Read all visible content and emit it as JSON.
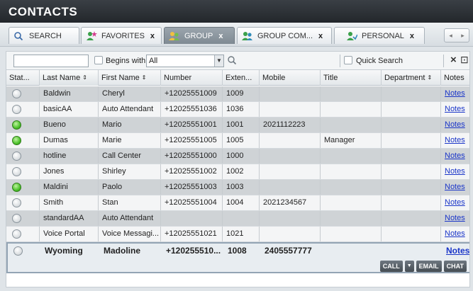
{
  "header": {
    "title": "CONTACTS"
  },
  "tabs": [
    {
      "label": "SEARCH",
      "icon": "search-icon",
      "closable": false,
      "active": false
    },
    {
      "label": "FAVORITES",
      "icon": "favorites-icon",
      "closable": true,
      "active": false
    },
    {
      "label": "GROUP",
      "icon": "group-icon",
      "closable": true,
      "active": true
    },
    {
      "label": "GROUP COM...",
      "icon": "group-common-icon",
      "closable": true,
      "active": false
    },
    {
      "label": "PERSONAL",
      "icon": "personal-icon",
      "closable": true,
      "active": false
    }
  ],
  "tab_close": "x",
  "tab_nav": {
    "prev": "◂",
    "next": "▸"
  },
  "toolbar": {
    "filter_value": "",
    "begins_with_label": "Begins with",
    "select_value": "All",
    "quick_search_label": "Quick Search",
    "clear_icon": "×",
    "export_icon": "⊡"
  },
  "columns": [
    {
      "key": "status",
      "label": "Stat..."
    },
    {
      "key": "last",
      "label": "Last Name",
      "sort": "⇕"
    },
    {
      "key": "first",
      "label": "First Name",
      "sort": "⇕"
    },
    {
      "key": "number",
      "label": "Number"
    },
    {
      "key": "ext",
      "label": "Exten..."
    },
    {
      "key": "mobile",
      "label": "Mobile"
    },
    {
      "key": "title",
      "label": "Title"
    },
    {
      "key": "dept",
      "label": "Department",
      "sort": "⇕"
    },
    {
      "key": "notes",
      "label": "Notes"
    }
  ],
  "rows": [
    {
      "presence": "offline",
      "last": "Baldwin",
      "first": "Cheryl",
      "number": "+12025551009",
      "ext": "1009",
      "mobile": "",
      "title": "",
      "dept": "",
      "notes": "Notes"
    },
    {
      "presence": "offline",
      "last": "basicAA",
      "first": "Auto Attendant",
      "number": "+12025551036",
      "ext": "1036",
      "mobile": "",
      "title": "",
      "dept": "",
      "notes": "Notes"
    },
    {
      "presence": "available",
      "last": "Bueno",
      "first": "Mario",
      "number": "+12025551001",
      "ext": "1001",
      "mobile": "2021112223",
      "title": "",
      "dept": "",
      "notes": "Notes"
    },
    {
      "presence": "available",
      "last": "Dumas",
      "first": "Marie",
      "number": "+12025551005",
      "ext": "1005",
      "mobile": "",
      "title": "Manager",
      "dept": "",
      "notes": "Notes"
    },
    {
      "presence": "offline",
      "last": "hotline",
      "first": "Call Center",
      "number": "+12025551000",
      "ext": "1000",
      "mobile": "",
      "title": "",
      "dept": "",
      "notes": "Notes"
    },
    {
      "presence": "offline",
      "last": "Jones",
      "first": "Shirley",
      "number": "+12025551002",
      "ext": "1002",
      "mobile": "",
      "title": "",
      "dept": "",
      "notes": "Notes"
    },
    {
      "presence": "available",
      "last": "Maldini",
      "first": "Paolo",
      "number": "+12025551003",
      "ext": "1003",
      "mobile": "",
      "title": "",
      "dept": "",
      "notes": "Notes"
    },
    {
      "presence": "offline",
      "last": "Smith",
      "first": "Stan",
      "number": "+12025551004",
      "ext": "1004",
      "mobile": "2021234567",
      "title": "",
      "dept": "",
      "notes": "Notes"
    },
    {
      "presence": "offline",
      "last": "standardAA",
      "first": "Auto Attendant",
      "number": "",
      "ext": "",
      "mobile": "",
      "title": "",
      "dept": "",
      "notes": "Notes"
    },
    {
      "presence": "offline",
      "last": "Voice Portal",
      "first": "Voice Messagi...",
      "number": "+12025551021",
      "ext": "1021",
      "mobile": "",
      "title": "",
      "dept": "",
      "notes": "Notes"
    }
  ],
  "selected_row": {
    "presence": "offline",
    "last": "Wyoming",
    "first": "Madoline",
    "number": "+120255510...",
    "ext": "1008",
    "mobile": "2405557777",
    "title": "",
    "dept": "",
    "notes": "Notes"
  },
  "row_actions": {
    "call": "CALL",
    "call_menu": "▼",
    "email": "EMAIL",
    "chat": "CHAT"
  },
  "colors": {
    "available": "#4cc22b",
    "offline": "#d7dbde",
    "link": "#1a35c8"
  }
}
